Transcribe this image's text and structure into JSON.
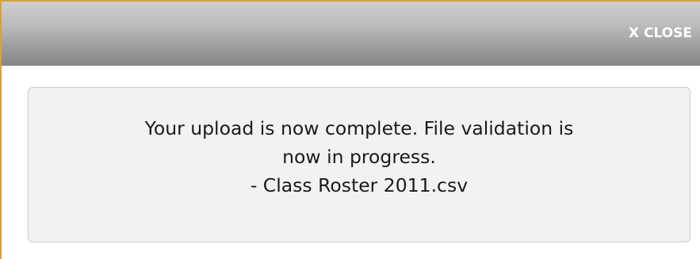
{
  "dialog": {
    "close_label": "X CLOSE",
    "message_lines": [
      "Your upload is now complete. File validation is",
      "now in progress.",
      "- Class Roster 2011.csv"
    ]
  },
  "colors": {
    "frame_border": "#e3a11f",
    "title_bar_top": "#cfcfcf",
    "title_bar_bottom": "#858585",
    "message_background": "#f2f2f2",
    "message_border": "#cdcdcd"
  }
}
